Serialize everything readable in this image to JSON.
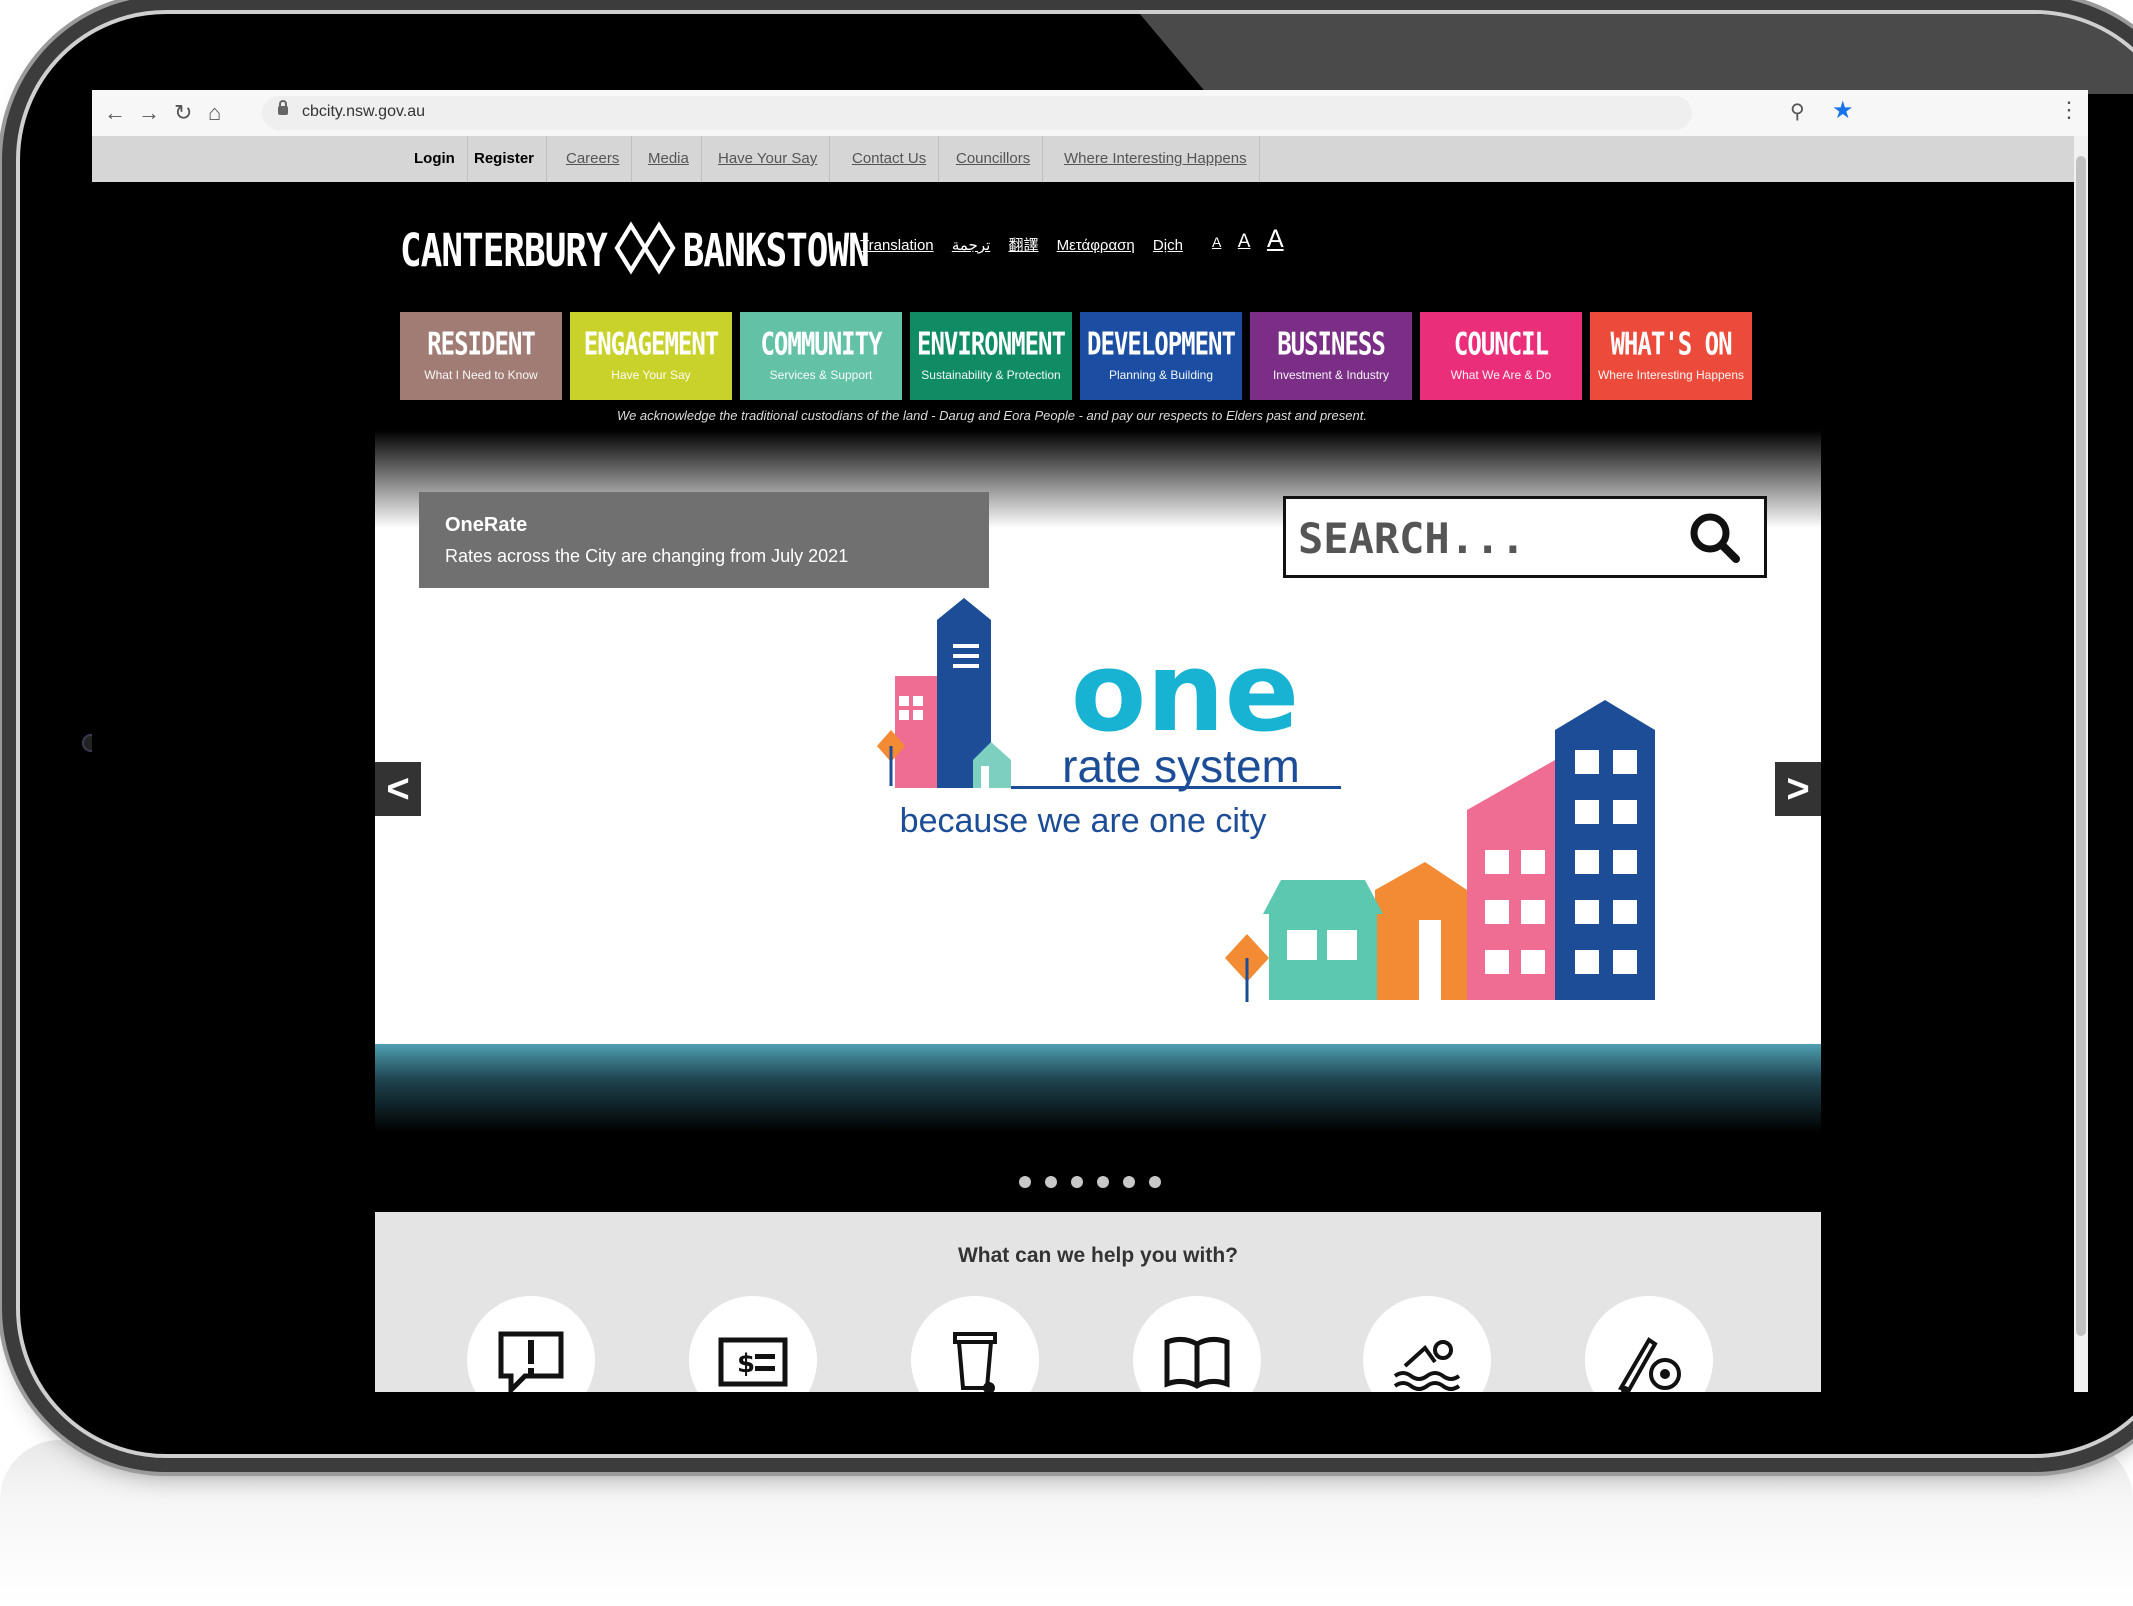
{
  "browser": {
    "url": "cbcity.nsw.gov.au",
    "icons": [
      "back-icon",
      "forward-icon",
      "reload-icon",
      "home-icon",
      "lock-icon",
      "zoom-icon",
      "bookmark-star-icon",
      "menu-icon"
    ]
  },
  "utility_nav": {
    "login": "Login",
    "register": "Register",
    "links": [
      "Careers",
      "Media",
      "Have Your Say",
      "Contact Us",
      "Councillors",
      "Where Interesting Happens"
    ]
  },
  "header": {
    "logo_left": "CANTERBURY",
    "logo_right": "BANKSTOWN",
    "languages": [
      "Translation",
      "ترجمة",
      "翻譯",
      "Μετάφραση",
      "Dịch"
    ],
    "font_sizes": [
      "A",
      "A",
      "A"
    ]
  },
  "main_nav": [
    {
      "title": "RESIDENT",
      "subtitle": "What I Need to Know",
      "color": "#a07c74"
    },
    {
      "title": "ENGAGEMENT",
      "subtitle": "Have Your Say",
      "color": "#c9d22a"
    },
    {
      "title": "COMMUNITY",
      "subtitle": "Services & Support",
      "color": "#63c1a6"
    },
    {
      "title": "ENVIRONMENT",
      "subtitle": "Sustainability & Protection",
      "color": "#0f8c63"
    },
    {
      "title": "DEVELOPMENT",
      "subtitle": "Planning & Building",
      "color": "#1b4ea3"
    },
    {
      "title": "BUSINESS",
      "subtitle": "Investment & Industry",
      "color": "#7a2e86"
    },
    {
      "title": "COUNCIL",
      "subtitle": "What We Are & Do",
      "color": "#ea2e7a"
    },
    {
      "title": "WHAT'S ON",
      "subtitle": "Where Interesting Happens",
      "color": "#ec4b3c"
    }
  ],
  "acknowledgement": "We acknowledge the traditional custodians of the land - Darug and Eora People - and pay our respects to Elders past and present.",
  "hero": {
    "card_title": "OneRate",
    "card_text": "Rates across the City are changing from July 2021",
    "search_placeholder": "SEARCH...",
    "banner_big": "one",
    "banner_line1": "rate system",
    "banner_line2": "because we are one city",
    "prev": "<",
    "next": ">",
    "slide_count": 6
  },
  "help": {
    "title": "What can we help you with?",
    "icons": [
      "report-issue-icon",
      "payment-icon",
      "waste-bin-icon",
      "library-book-icon",
      "swimming-icon",
      "sport-icon"
    ]
  },
  "colors": {
    "one_cyan": "#18b3d2",
    "navy": "#1c4d96",
    "pink": "#ef6d93",
    "orange": "#f28b33",
    "teal": "#5cc8b0"
  }
}
